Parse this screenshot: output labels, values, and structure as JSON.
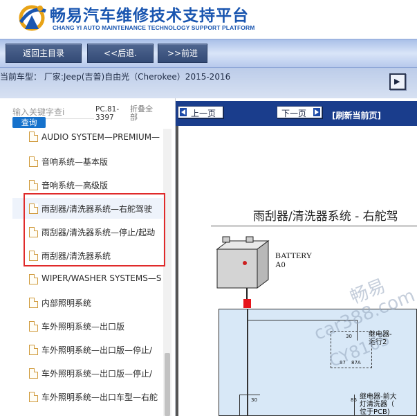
{
  "header": {
    "title_cn": "畅易汽车维修技术支持平台",
    "title_en": "CHANG YI AUTO MAINTENANCE TECHNOLOGY SUPPORT PLATFORM"
  },
  "nav": {
    "home_label": "返回主目录",
    "back_label": "<<后退.",
    "forward_label": ">>前进"
  },
  "car": {
    "current_label": "当前车型：  厂家:Jeep(吉普)自由光（Cherokee）2015-2016"
  },
  "left": {
    "search_placeholder": "输入关键字查i",
    "search_button": "查询",
    "pc_code": "PC.81-3397",
    "collapse_all": "折叠全部",
    "items": [
      {
        "label": "AUDIO SYSTEM—PREMIUM—"
      },
      {
        "label": "音响系统—基本版"
      },
      {
        "label": "音响系统—高级版"
      },
      {
        "label": "雨刮器/清洗器系统—右舵驾驶"
      },
      {
        "label": "雨刮器/清洗器系统—停止/起动"
      },
      {
        "label": "雨刮器/清洗器系统"
      },
      {
        "label": "WIPER/WASHER SYSTEMS—S"
      },
      {
        "label": "内部照明系统"
      },
      {
        "label": "车外照明系统—出口版"
      },
      {
        "label": "车外照明系统—出口版—停止/"
      },
      {
        "label": "车外照明系统—出口版—停止/"
      },
      {
        "label": "车外照明系统—出口车型—右舵"
      }
    ]
  },
  "doc": {
    "prev_label": "上一页",
    "next_label": "下一页",
    "refresh_label": "[刷新当前页]",
    "diagram_title": "雨刮器/清洗器系统 - 右舵驾",
    "battery_label_1": "BATTERY",
    "battery_label_2": "A0",
    "relay_run_1": "继电器-",
    "relay_run_2": "运行2",
    "relay_washer_1": "继电器-前大",
    "relay_washer_2": "灯清洗器（",
    "relay_washer_3": "位于PCB)",
    "pin_30a": "30",
    "pin_87": "87",
    "pin_87a": "87A",
    "pin_86": "86",
    "pin_30b": "30",
    "watermark_1": "畅易",
    "watermark_2": "car388.com",
    "watermark_3": "CY8165"
  }
}
